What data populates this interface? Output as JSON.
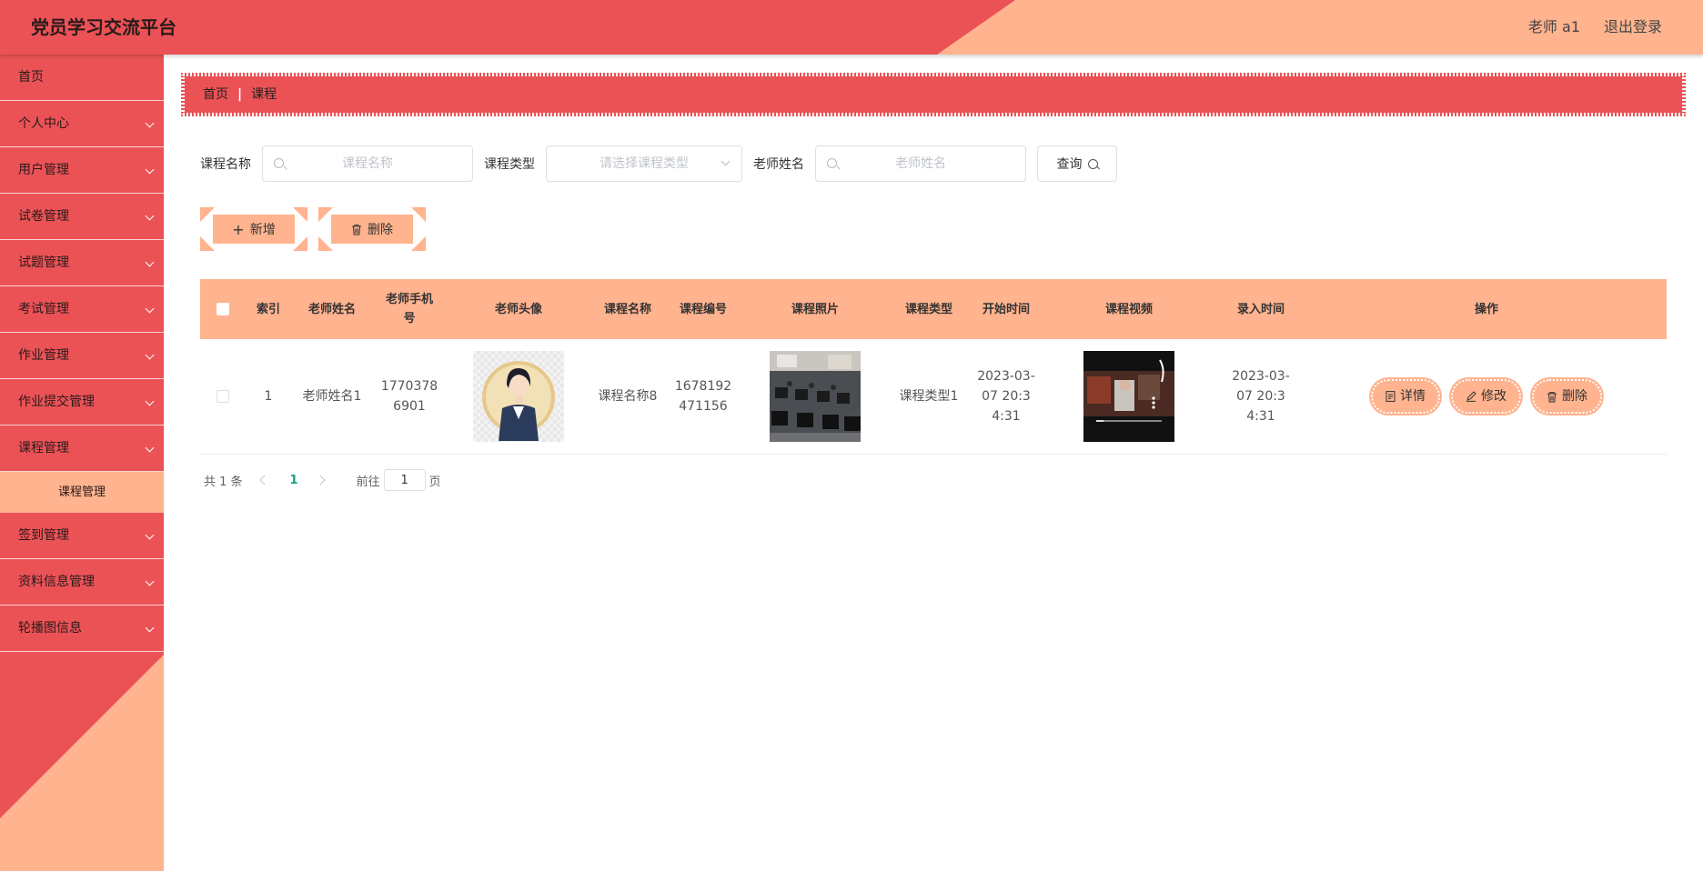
{
  "header": {
    "title": "党员学习交流平台",
    "user": "老师 a1",
    "logout": "退出登录"
  },
  "sidebar": {
    "items": [
      {
        "label": "首页",
        "expandable": false
      },
      {
        "label": "个人中心",
        "expandable": true
      },
      {
        "label": "用户管理",
        "expandable": true
      },
      {
        "label": "试卷管理",
        "expandable": true
      },
      {
        "label": "试题管理",
        "expandable": true
      },
      {
        "label": "考试管理",
        "expandable": true
      },
      {
        "label": "作业管理",
        "expandable": true
      },
      {
        "label": "作业提交管理",
        "expandable": true
      },
      {
        "label": "课程管理",
        "expandable": true
      },
      {
        "label": "签到管理",
        "expandable": true
      },
      {
        "label": "资料信息管理",
        "expandable": true
      },
      {
        "label": "轮播图信息",
        "expandable": true
      }
    ],
    "sub_item": "课程管理"
  },
  "breadcrumb": {
    "home": "首页",
    "separator": "|",
    "current": "课程"
  },
  "search": {
    "course_name_label": "课程名称",
    "course_name_placeholder": "课程名称",
    "course_type_label": "课程类型",
    "course_type_placeholder": "请选择课程类型",
    "teacher_name_label": "老师姓名",
    "teacher_name_placeholder": "老师姓名",
    "query_label": "查询"
  },
  "actions": {
    "add_label": "新增",
    "delete_label": "删除"
  },
  "table": {
    "headers": {
      "index": "索引",
      "teacher_name": "老师姓名",
      "teacher_phone": "老师手机号",
      "teacher_avatar": "老师头像",
      "course_name": "课程名称",
      "course_no": "课程编号",
      "course_photo": "课程照片",
      "course_type": "课程类型",
      "start_time": "开始时间",
      "course_video": "课程视频",
      "entry_time": "录入时间",
      "operation": "操作"
    },
    "rows": [
      {
        "index": "1",
        "teacher_name": "老师姓名1",
        "teacher_phone": "17703786901",
        "course_name": "课程名称8",
        "course_no": "1678192471156",
        "course_type": "课程类型1",
        "start_time": "2023-03-07 20:34:31",
        "entry_time": "2023-03-07 20:34:31"
      }
    ],
    "row_actions": {
      "detail": "详情",
      "edit": "修改",
      "delete": "删除"
    }
  },
  "pagination": {
    "total": "共 1 条",
    "current_page": "1",
    "goto_prefix": "前往",
    "goto_value": "1",
    "goto_suffix": "页"
  },
  "colors": {
    "accent_red": "#eb5256",
    "accent_peach": "#ffb38e",
    "page_active": "#16a085"
  }
}
